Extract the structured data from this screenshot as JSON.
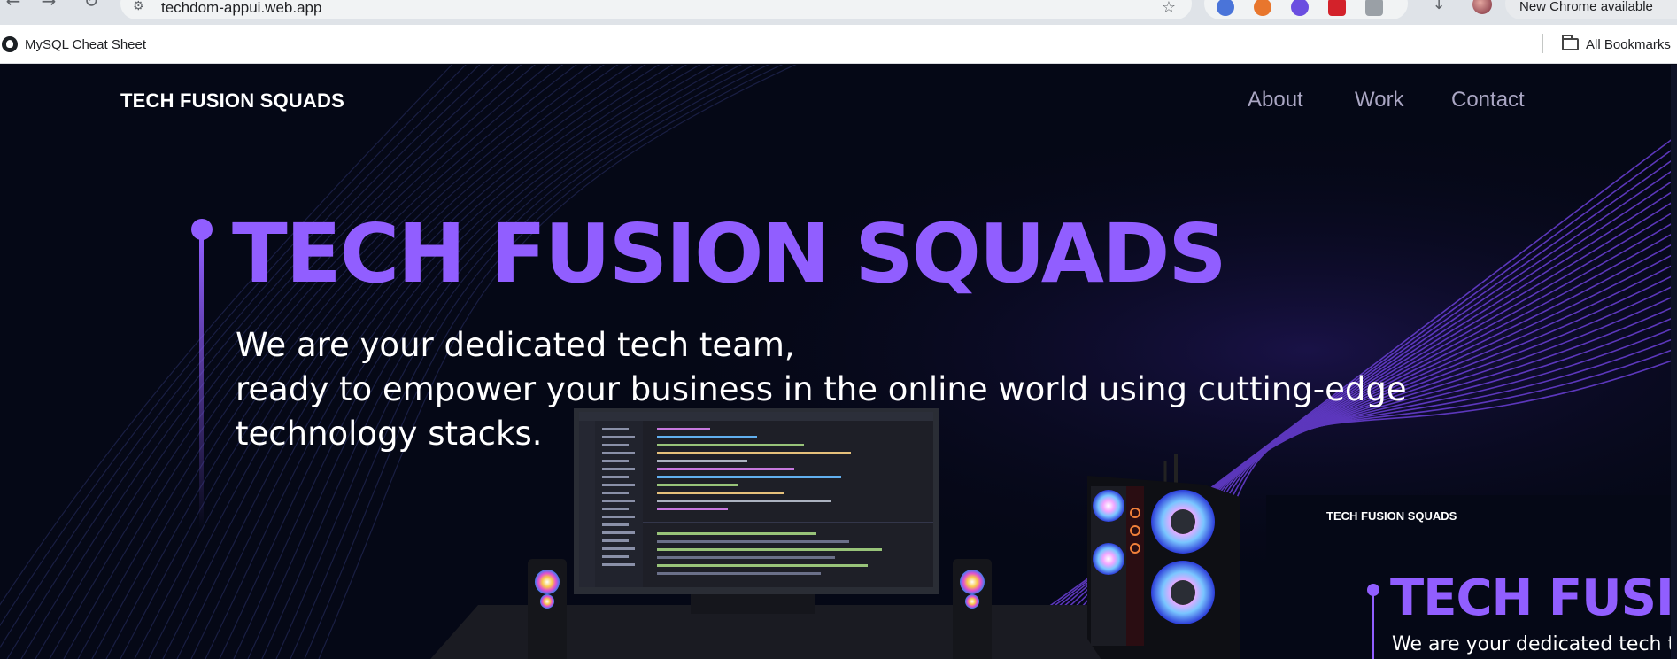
{
  "browser": {
    "url": "techdom-appui.web.app",
    "update_label": "New Chrome available",
    "bookmarks": [
      {
        "label": "MySQL Cheat Sheet"
      }
    ],
    "all_bookmarks_label": "All Bookmarks"
  },
  "site": {
    "brand": "TECH FUSION SQUADS",
    "nav": [
      {
        "label": "About"
      },
      {
        "label": "Work"
      },
      {
        "label": "Contact"
      }
    ],
    "hero": {
      "title": "TECH FUSION SQUADS",
      "subtitle_lines": [
        "We are your dedicated tech team,",
        "ready to empower your business in the online world using cutting-edge",
        "technology stacks."
      ]
    },
    "accent_color": "#915eff",
    "background_color": "#050816"
  },
  "preview": {
    "brand": "TECH FUSION SQUADS",
    "title": "TECH FUSIO",
    "subtitle": "We are your dedicated tech t"
  }
}
